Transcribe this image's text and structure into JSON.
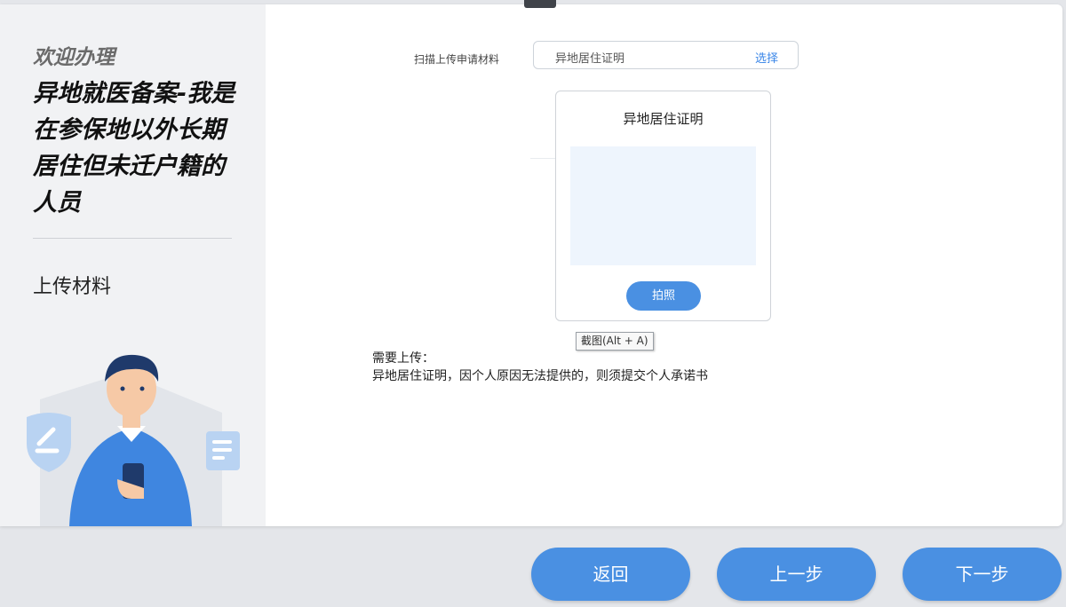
{
  "sidebar": {
    "welcome": "欢迎办理",
    "service_title": "异地就医备案-我是在参保地以外长期居住但未迁户籍的人员",
    "current_step": "上传材料"
  },
  "upload": {
    "label": "扫描上传申请材料",
    "selected_value": "异地居住证明",
    "select_button": "选择"
  },
  "photo_card": {
    "title": "异地居住证明",
    "photo_button": "拍照"
  },
  "tooltip": "截图(Alt + A)",
  "requirements": {
    "title": "需要上传：",
    "text": "异地居住证明，因个人原因无法提供的，则须提交个人承诺书"
  },
  "buttons": {
    "back": "返回",
    "prev": "上一步",
    "next": "下一步"
  },
  "colors": {
    "accent": "#4a90e2",
    "link": "#3a86e8",
    "sidebar_bg": "#f1f2f4"
  }
}
